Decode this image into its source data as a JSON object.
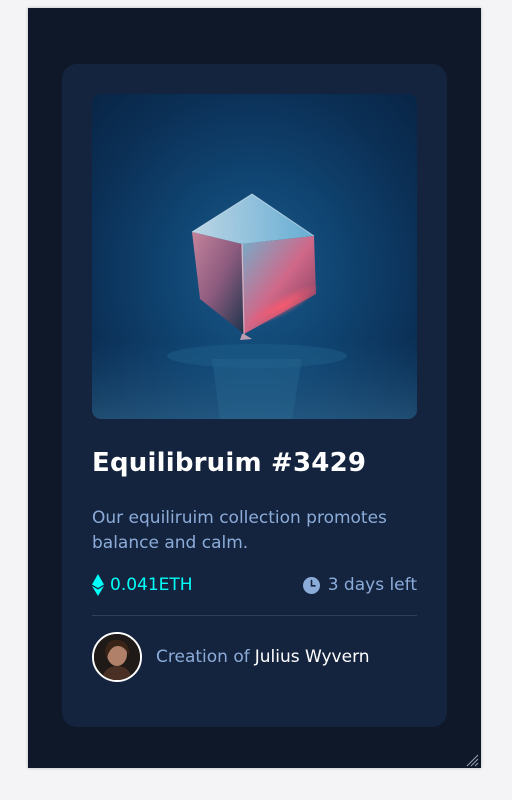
{
  "card": {
    "title": "Equilibruim #3429",
    "description": "Our equiliruim collection promotes balance and calm.",
    "price": "0.041ETH",
    "time_left": "3 days left",
    "creator_prefix": "Creation of",
    "creator_name": "Julius Wyvern"
  },
  "icons": {
    "price": "ethereum-icon",
    "time": "clock-icon"
  },
  "colors": {
    "page_background": "#0f1829",
    "card_background": "#15243e",
    "accent_cyan": "#00fff8",
    "soft_blue": "#8bacd9",
    "white": "#ffffff",
    "divider": "#2e405a"
  }
}
